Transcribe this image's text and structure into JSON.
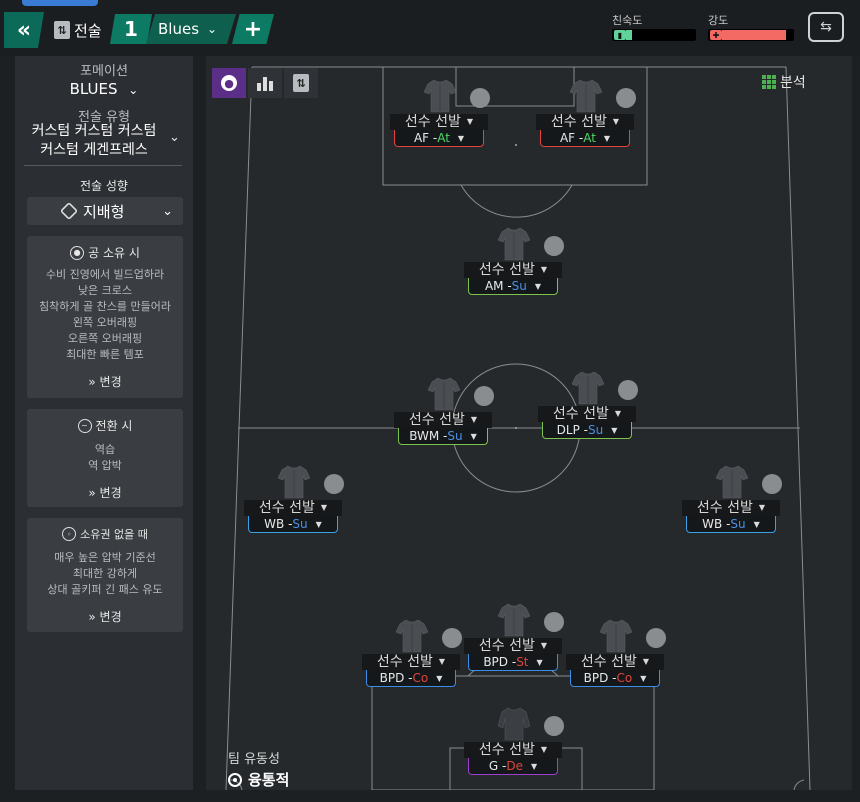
{
  "topbar": {
    "tactics_label": "전술",
    "tactic_number": "1",
    "tactic_name": "Blues",
    "add_label": "+",
    "familiarity_label": "친숙도",
    "intensity_label": "강도",
    "familiarity_level": 0.08,
    "intensity_level": 0.92
  },
  "sidebar": {
    "formation_label": "포메이션",
    "formation_value": "BLUES",
    "tactic_type_label": "전술 유형",
    "tactic_type_line1": "커스텀 커스텀 커스텀",
    "tactic_type_line2": "커스텀 게겐프레스",
    "style_label": "전술 성향",
    "style_value": "지배형",
    "in_possession": {
      "title": "공 소유 시",
      "lines": [
        "수비 진영에서 빌드업하라",
        "낮은 크로스",
        "침착하게 골 찬스를 만들어라",
        "왼쪽 오버래핑",
        "오른쪽 오버래핑",
        "최대한 빠른 템포"
      ],
      "change": "변경"
    },
    "in_transition": {
      "title": "전환 시",
      "lines": [
        "역습",
        "역 압박"
      ],
      "change": "변경"
    },
    "out_of_possession": {
      "title": "소유권 없을 때",
      "lines": [
        "매우 높은 압박 기준선",
        "최대한 강하게",
        "상대 골키퍼 긴 패스 유도"
      ],
      "change": "변경"
    }
  },
  "pitch": {
    "analysis_label": "분석",
    "fluidity_label": "팀 유동성",
    "fluidity_value": "융통적",
    "select_player": "선수 선발",
    "players": [
      {
        "role": "AF",
        "duty": "At",
        "duty_color": "#4cd964",
        "line_color": "#e0443a"
      },
      {
        "role": "AF",
        "duty": "At",
        "duty_color": "#4cd964",
        "line_color": "#e0443a"
      },
      {
        "role": "AM",
        "duty": "Su",
        "duty_color": "#4a90e2",
        "line_color": "#7dc24b"
      },
      {
        "role": "BWM",
        "duty": "Su",
        "duty_color": "#4a90e2",
        "line_color": "#7dc24b"
      },
      {
        "role": "DLP",
        "duty": "Su",
        "duty_color": "#4a90e2",
        "line_color": "#7dc24b"
      },
      {
        "role": "WB",
        "duty": "Su",
        "duty_color": "#4a90e2",
        "line_color": "#3aa0e6"
      },
      {
        "role": "WB",
        "duty": "Su",
        "duty_color": "#4a90e2",
        "line_color": "#3aa0e6"
      },
      {
        "role": "BPD",
        "duty": "Co",
        "duty_color": "#e0443a",
        "line_color": "#3a8ee6"
      },
      {
        "role": "BPD",
        "duty": "St",
        "duty_color": "#e0443a",
        "line_color": "#3a8ee6"
      },
      {
        "role": "BPD",
        "duty": "Co",
        "duty_color": "#e0443a",
        "line_color": "#3a8ee6"
      },
      {
        "role": "G",
        "duty": "De",
        "duty_color": "#e0443a",
        "line_color": "#9b3fd0"
      }
    ]
  }
}
